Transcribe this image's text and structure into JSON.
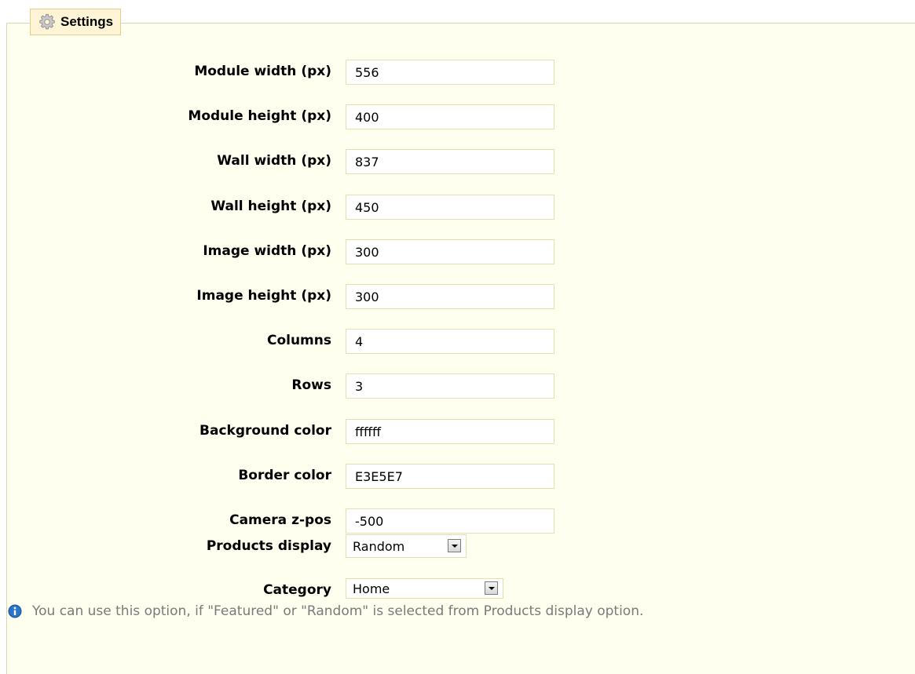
{
  "fieldset": {
    "legend": "Settings",
    "icon": "gear-icon"
  },
  "fields": [
    {
      "label": "Module width (px)",
      "value": "556"
    },
    {
      "label": "Module height (px)",
      "value": "400"
    },
    {
      "label": "Wall width (px)",
      "value": "837"
    },
    {
      "label": "Wall height (px)",
      "value": "450"
    },
    {
      "label": "Image width (px)",
      "value": "300"
    },
    {
      "label": "Image height (px)",
      "value": "300"
    },
    {
      "label": "Columns",
      "value": "4"
    },
    {
      "label": "Rows",
      "value": "3"
    },
    {
      "label": "Background color",
      "value": "ffffff"
    },
    {
      "label": "Border color",
      "value": "E3E5E7"
    },
    {
      "label": "Camera z-pos",
      "value": "-500"
    }
  ],
  "products_display": {
    "label": "Products display",
    "selected": "Random"
  },
  "category": {
    "label": "Category",
    "selected": "Home"
  },
  "hint": {
    "icon": "info-icon",
    "text": "You can use this option, if \"Featured\" or \"Random\" is selected from Products display option."
  },
  "colors": {
    "panel_bg": "#fffff0",
    "legend_bg": "#fff5d6",
    "input_border": "#e6dfae",
    "hint_text": "#7a7a7a",
    "info_icon": "#2a74c9"
  }
}
